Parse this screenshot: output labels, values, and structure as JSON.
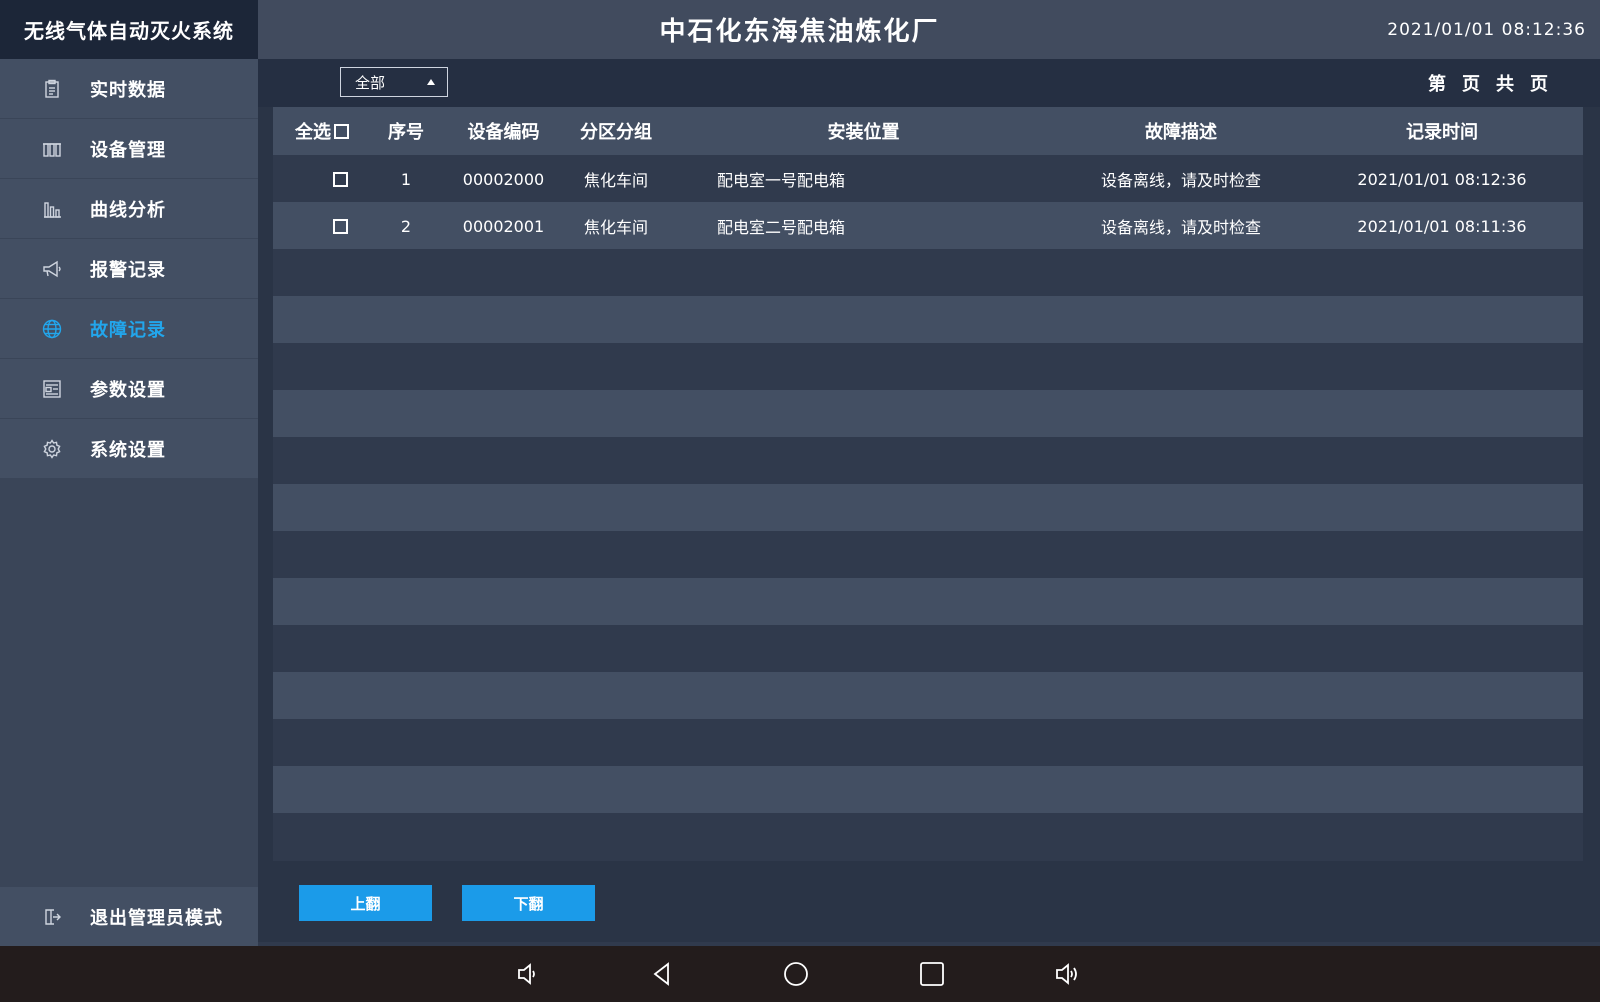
{
  "brand": "无线气体自动灭火系统",
  "header": {
    "title": "中石化东海焦油炼化厂",
    "clock": "2021/01/01 08:12:36"
  },
  "sidebar": {
    "items": [
      {
        "label": "实时数据",
        "icon": "clipboard-icon",
        "active": false
      },
      {
        "label": "设备管理",
        "icon": "device-rack-icon",
        "active": false
      },
      {
        "label": "曲线分析",
        "icon": "bar-chart-icon",
        "active": false
      },
      {
        "label": "报警记录",
        "icon": "megaphone-icon",
        "active": false
      },
      {
        "label": "故障记录",
        "icon": "globe-icon",
        "active": true
      },
      {
        "label": "参数设置",
        "icon": "form-icon",
        "active": false
      },
      {
        "label": "系统设置",
        "icon": "gear-icon",
        "active": false
      }
    ],
    "exit_label": "退出管理员模式"
  },
  "toolbar": {
    "filter_value": "全部",
    "pager": [
      "第",
      "页",
      "共",
      "页"
    ]
  },
  "table": {
    "columns": [
      "全选",
      "序号",
      "设备编码",
      "分区分组",
      "安装位置",
      "故障描述",
      "记录时间"
    ],
    "rows": [
      {
        "index": "1",
        "code": "00002000",
        "zone": "焦化车间",
        "location": "配电室一号配电箱",
        "fault": "设备离线，请及时检查",
        "time": "2021/01/01 08:12:36"
      },
      {
        "index": "2",
        "code": "00002001",
        "zone": "焦化车间",
        "location": "配电室二号配电箱",
        "fault": "设备离线，请及时检查",
        "time": "2021/01/01 08:11:36"
      }
    ],
    "total_visible_rows": 15
  },
  "buttons": {
    "prev": "上翻",
    "next": "下翻"
  },
  "colors": {
    "accent": "#1b9be9",
    "active_text": "#22a6ec",
    "header_bg": "#414b5e",
    "row_alt": "#434f63"
  }
}
